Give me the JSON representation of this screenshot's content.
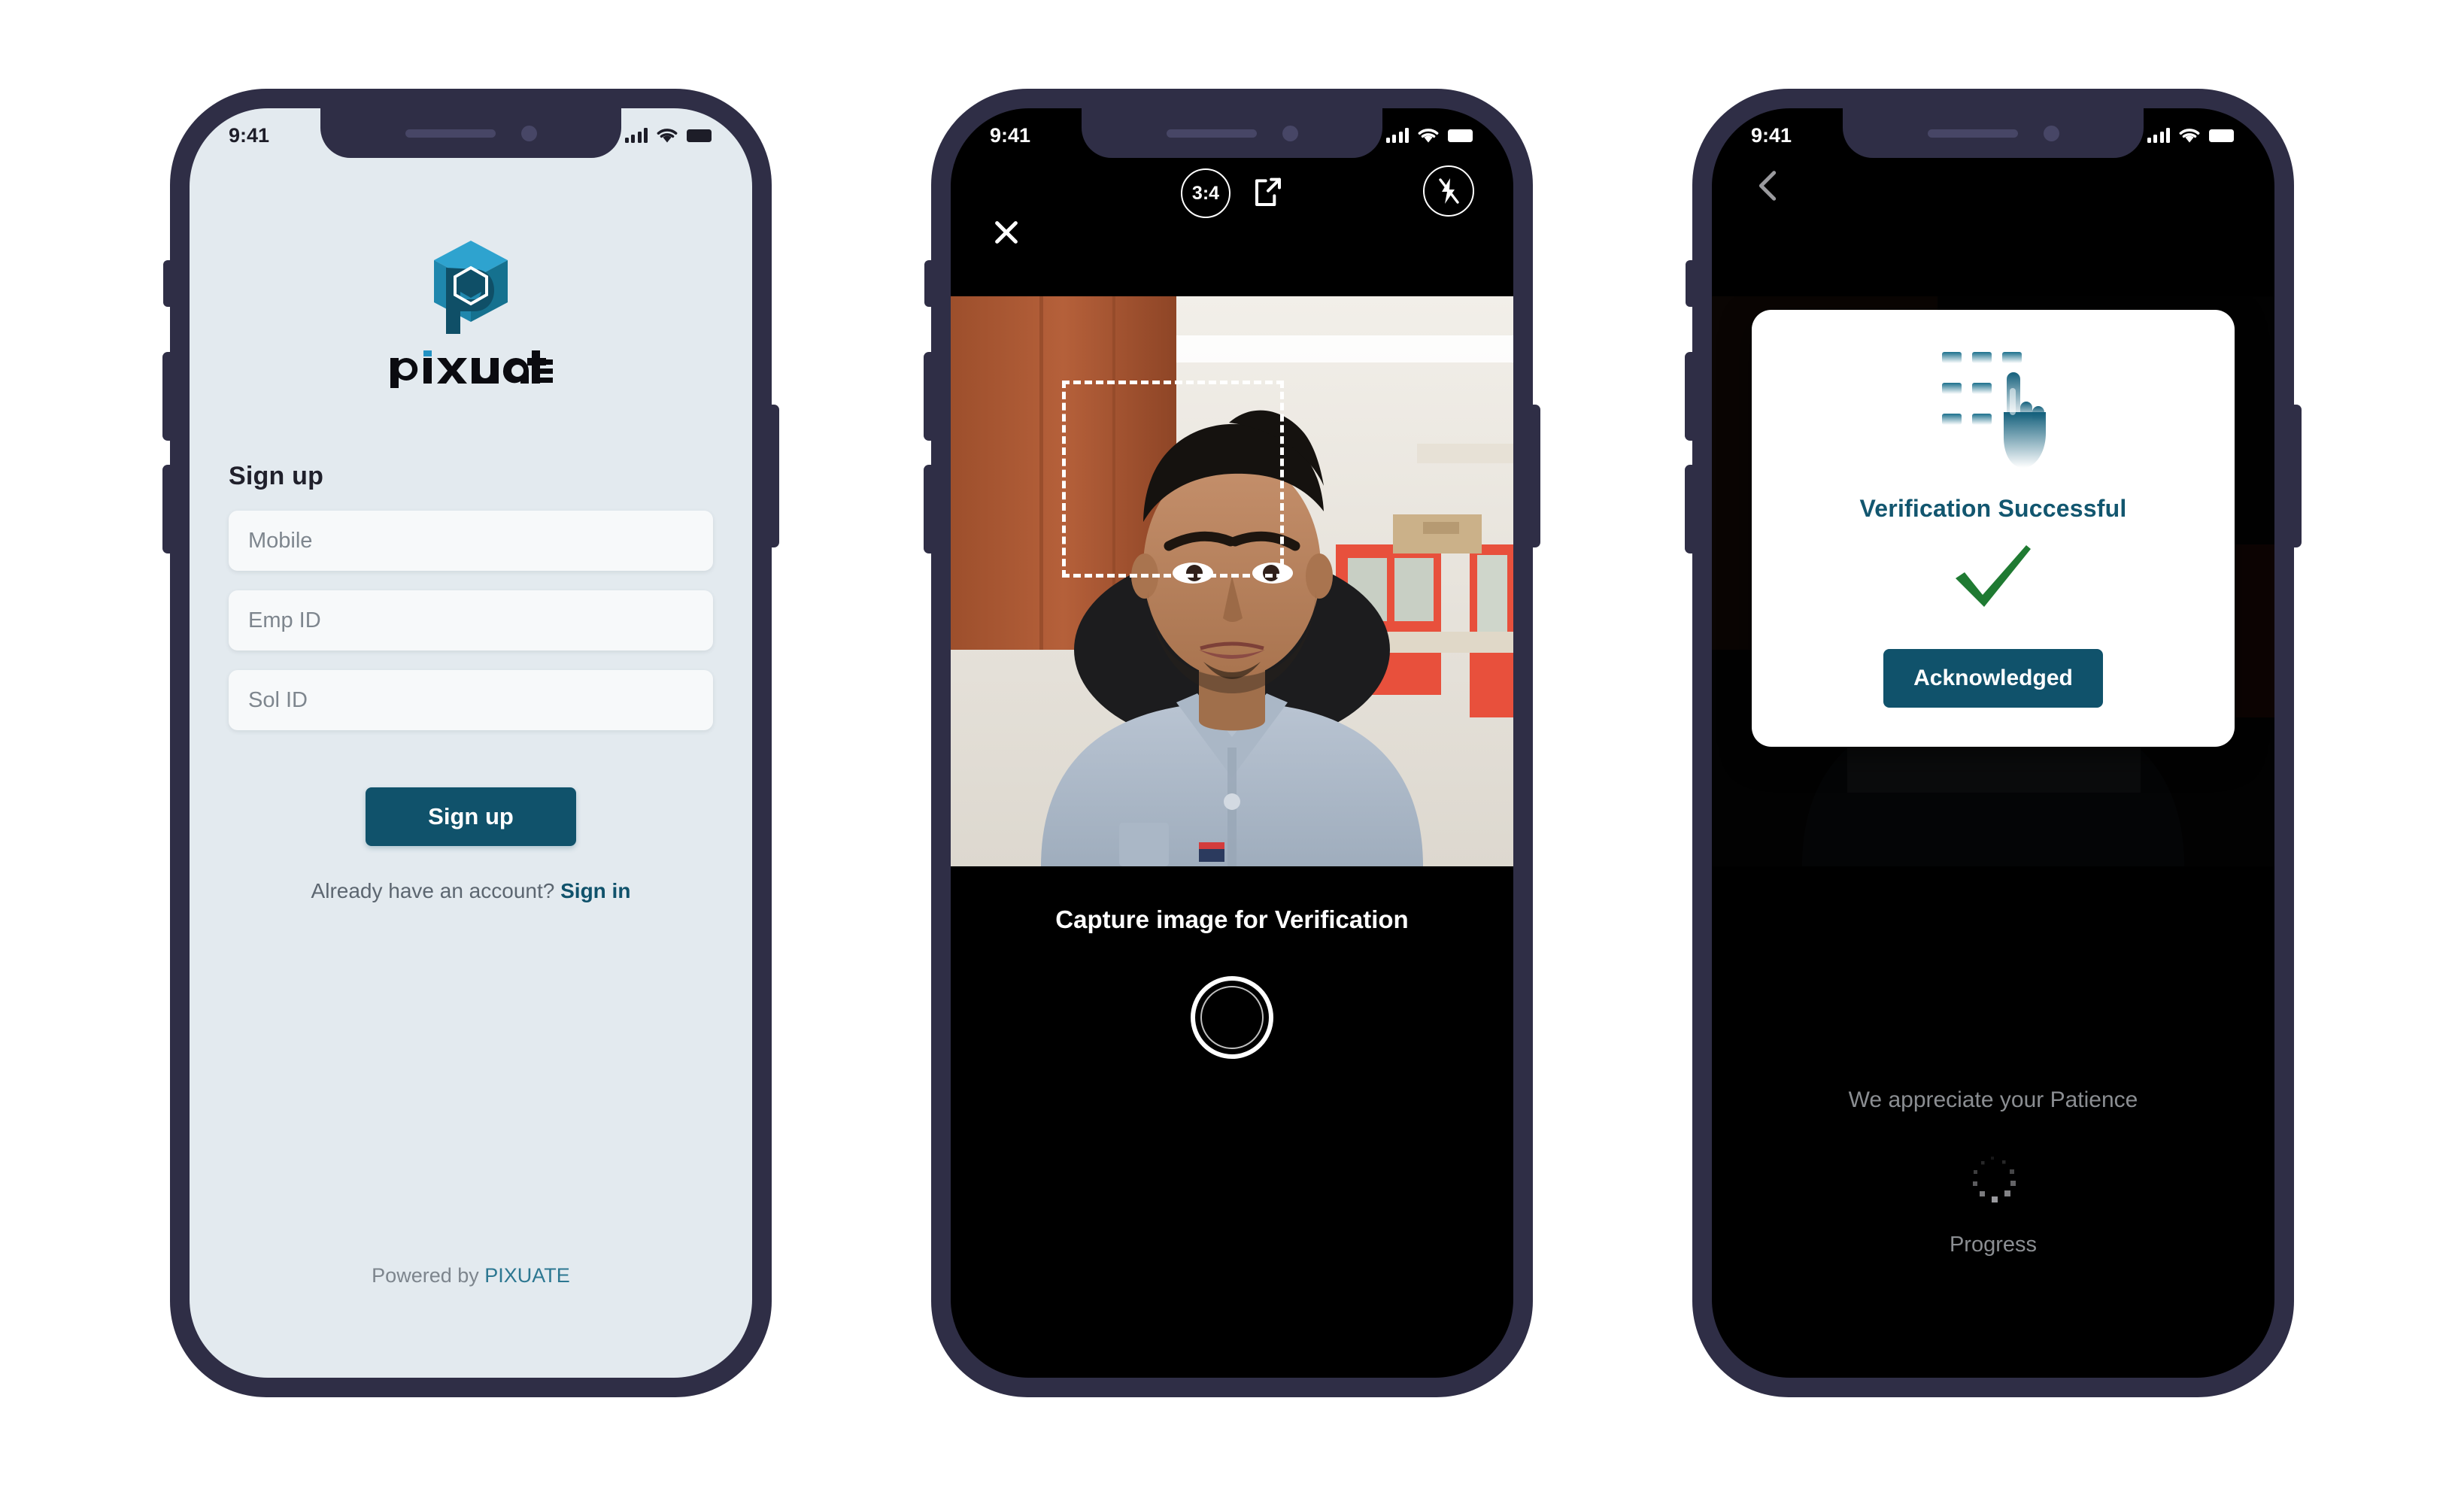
{
  "screens": [
    {
      "id": "signup",
      "status_bar": {
        "time": "9:41",
        "signal_icon": "cellular-bars-icon",
        "wifi_icon": "wifi-icon",
        "battery_icon": "battery-full-icon"
      },
      "logo": {
        "mark": "pixuate-cube-logo",
        "wordmark": "PIXUATE"
      },
      "title": "Sign up",
      "fields": [
        {
          "name": "mobile",
          "placeholder": "Mobile",
          "value": ""
        },
        {
          "name": "emp_id",
          "placeholder": "Emp ID",
          "value": ""
        },
        {
          "name": "sol_id",
          "placeholder": "Sol ID",
          "value": ""
        }
      ],
      "primary_button": "Sign up",
      "signin_prompt": "Already have an account?",
      "signin_link": "Sign in",
      "footer_prefix": "Powered by",
      "footer_brand": "PIXUATE"
    },
    {
      "id": "camera",
      "status_bar": {
        "time": "9:41",
        "signal_icon": "cellular-bars-icon",
        "wifi_icon": "wifi-icon",
        "battery_icon": "battery-full-icon"
      },
      "toolbar": {
        "close_icon": "close-x-icon",
        "aspect_ratio": "3:4",
        "share_icon": "external-link-icon",
        "flash_icon": "flash-off-icon"
      },
      "face_box": "face-detection-box",
      "caption": "Capture image for Verification",
      "shutter": "shutter-button"
    },
    {
      "id": "verification_result",
      "status_bar": {
        "time": "9:41",
        "signal_icon": "cellular-bars-icon",
        "wifi_icon": "wifi-icon",
        "battery_icon": "battery-full-icon"
      },
      "back_icon": "chevron-left-icon",
      "modal": {
        "icon": "touch-grid-hand-icon",
        "title": "Verification Successful",
        "check_icon": "green-check-icon",
        "button": "Acknowledged"
      },
      "patience_text": "We appreciate your Patience",
      "spinner_icon": "loading-spinner-icon",
      "progress_label": "Progress"
    }
  ],
  "colors": {
    "frame": "#2f2e46",
    "screen1_bg": "#e3eaef",
    "accent_teal": "#10526b",
    "brand_teal": "#2c7791",
    "title_teal": "#12566f",
    "check_green": "#1f7a32",
    "muted_text": "#8b8e92",
    "logo_blue": "#2392c3",
    "logo_dark": "#13566e"
  }
}
